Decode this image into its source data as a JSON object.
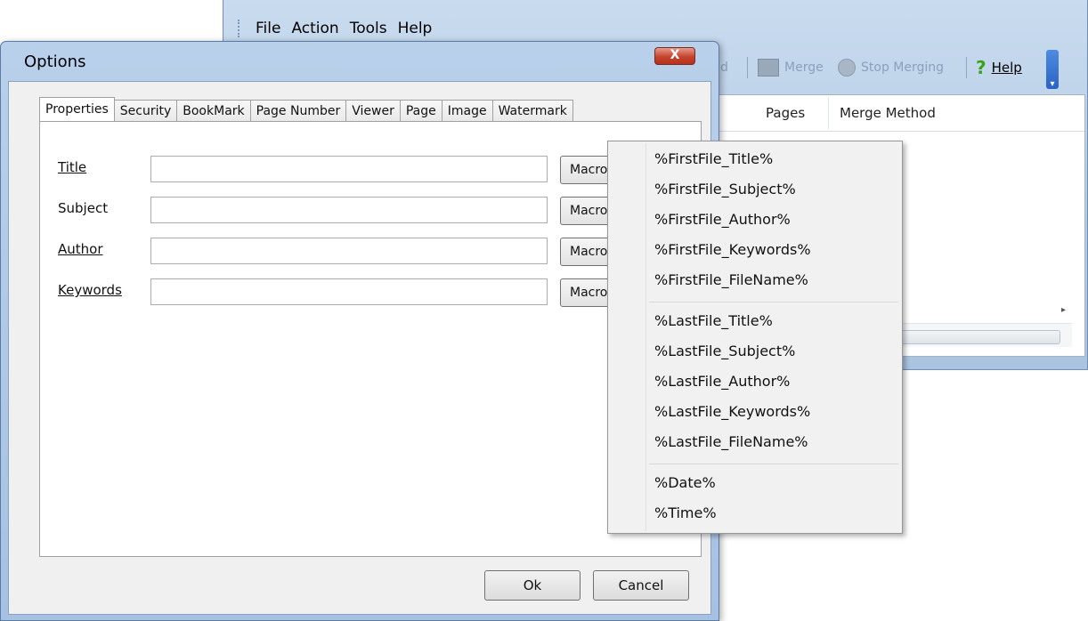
{
  "main_window": {
    "menu": [
      "File",
      "Action",
      "Tools",
      "Help"
    ],
    "toolbar": {
      "stub_label": "d",
      "merge_label": "Merge",
      "stop_label": "Stop Merging",
      "help_label": "Help"
    },
    "list_columns": [
      "Pages",
      "Merge Method"
    ]
  },
  "dialog": {
    "title": "Options",
    "close_glyph": "X",
    "tabs": [
      "Properties",
      "Security",
      "BookMark",
      "Page Number",
      "Viewer",
      "Page",
      "Image",
      "Watermark"
    ],
    "active_tab": "Properties",
    "fields": [
      {
        "label": "Title",
        "value": "",
        "button": "Macro"
      },
      {
        "label": "Subject",
        "value": "",
        "button": "Macro"
      },
      {
        "label": "Author",
        "value": "",
        "button": "Macro"
      },
      {
        "label": "Keywords",
        "value": "",
        "button": "Macro"
      }
    ],
    "ok_label": "Ok",
    "cancel_label": "Cancel"
  },
  "macro_menu": {
    "first_file": [
      "%FirstFile_Title%",
      "%FirstFile_Subject%",
      "%FirstFile_Author%",
      "%FirstFile_Keywords%",
      "%FirstFile_FileName%"
    ],
    "last_file": [
      "%LastFile_Title%",
      "%LastFile_Subject%",
      "%LastFile_Author%",
      "%LastFile_Keywords%",
      "%LastFile_FileName%"
    ],
    "date_time": [
      "%Date%",
      "%Time%"
    ]
  }
}
